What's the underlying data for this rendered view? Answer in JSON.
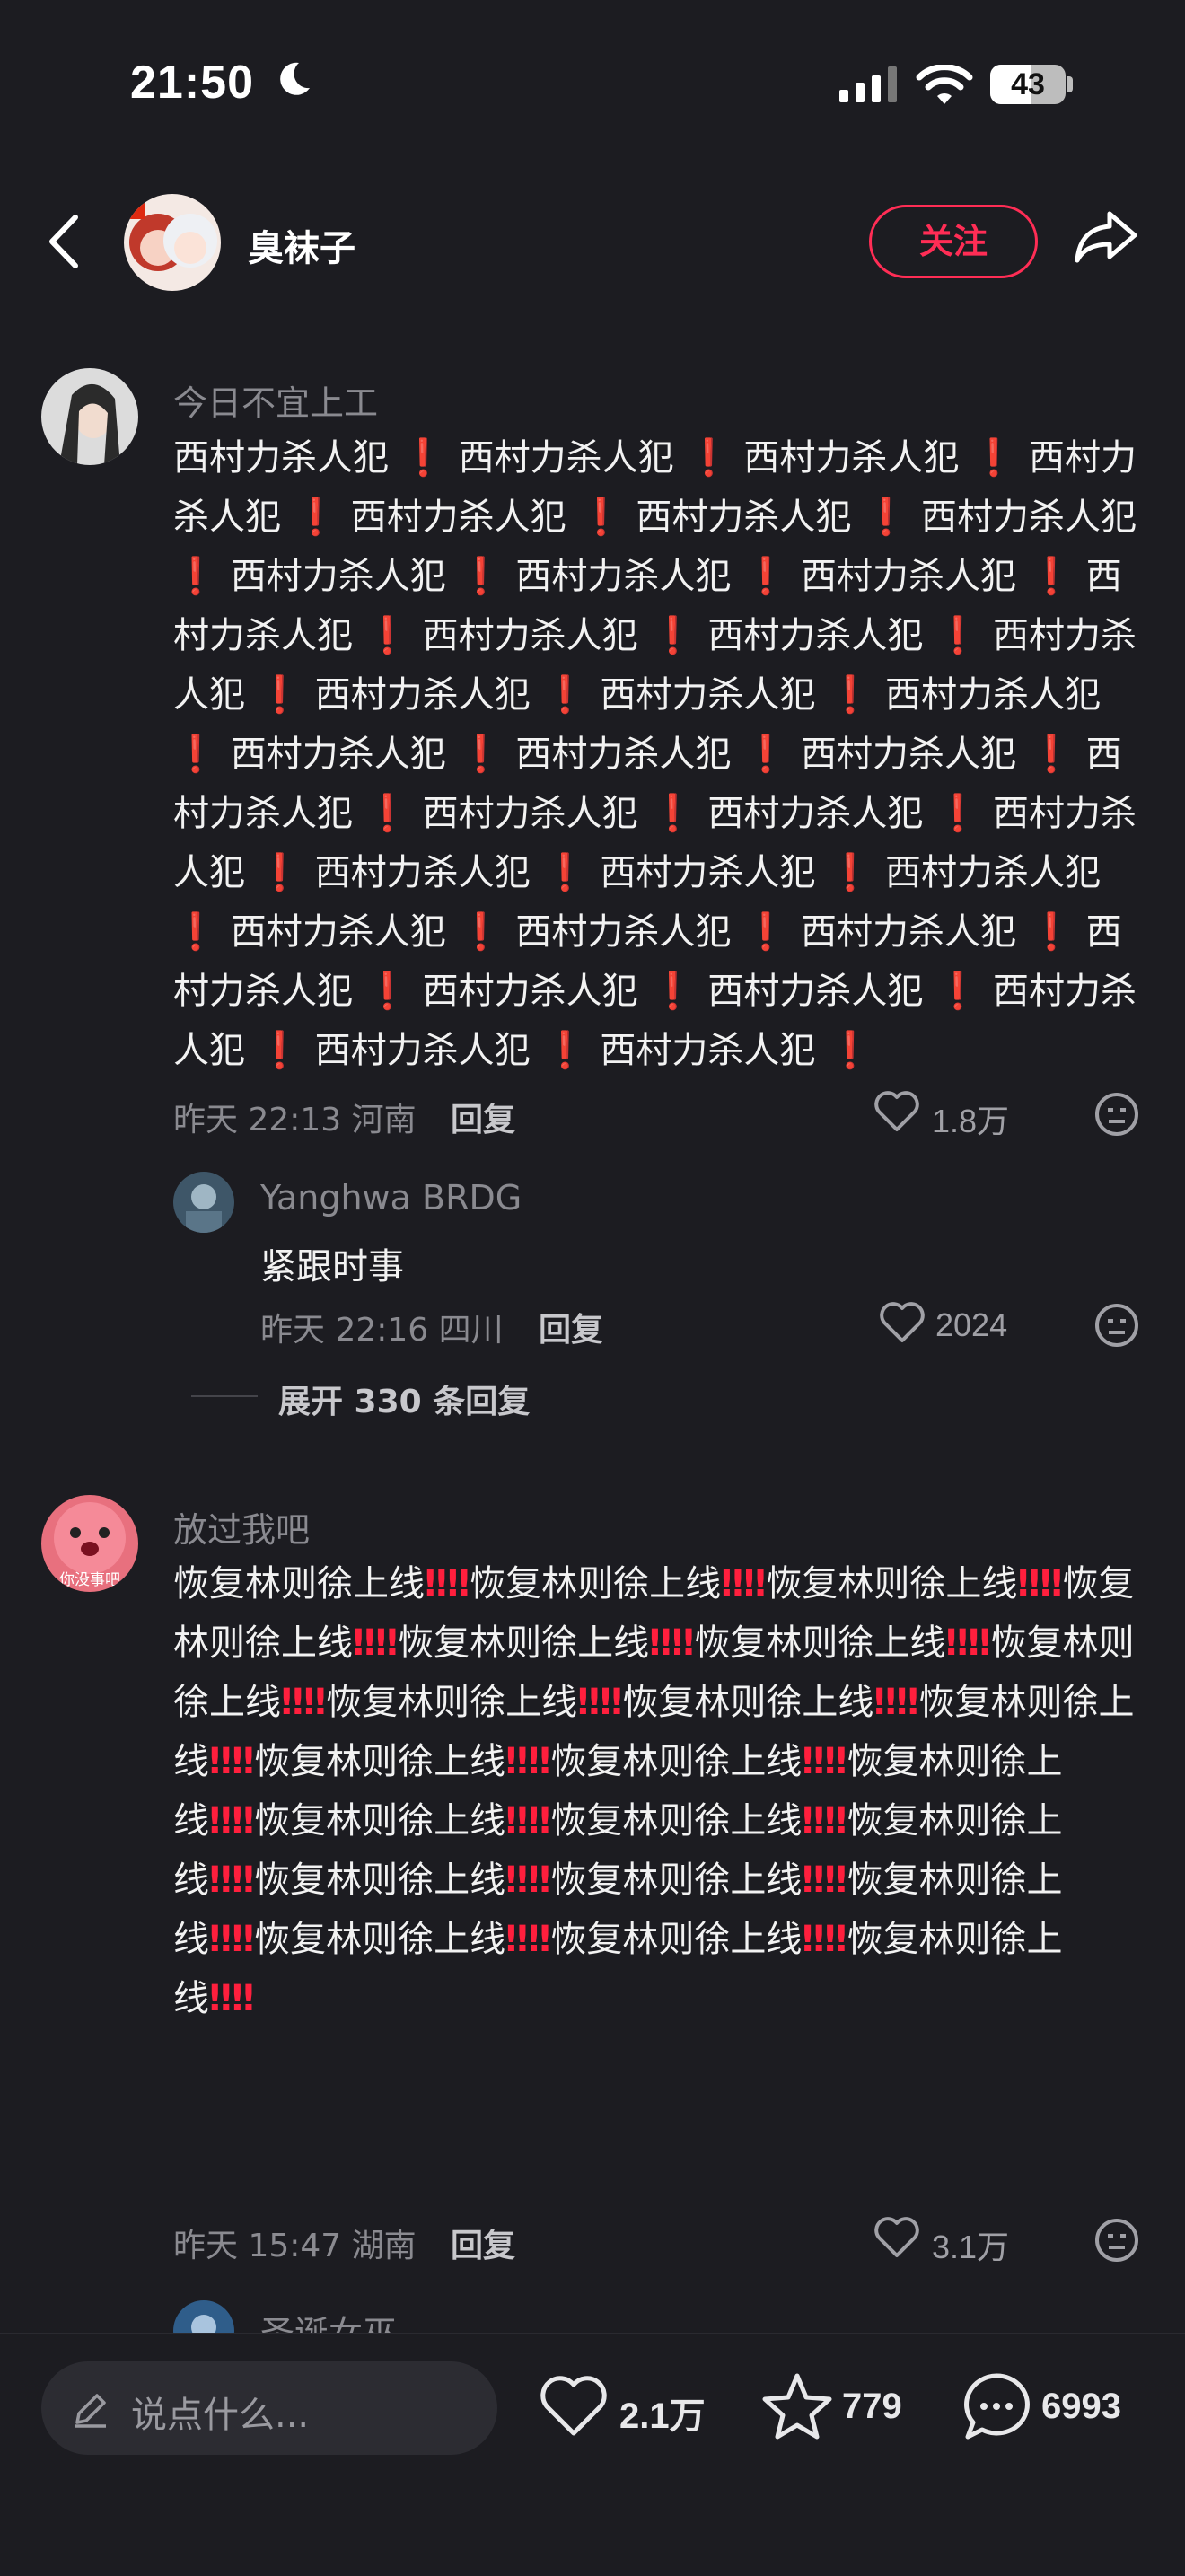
{
  "status": {
    "time": "21:50",
    "battery": "43"
  },
  "header": {
    "author": "臭袜子",
    "follow_label": "关注"
  },
  "comments": [
    {
      "user": "今日不宜上工",
      "text": "西村力杀人犯❗西村力杀人犯❗西村力杀人犯❗西村力杀人犯❗西村力杀人犯❗西村力杀人犯❗西村力杀人犯❗西村力杀人犯❗西村力杀人犯❗西村力杀人犯❗西村力杀人犯❗西村力杀人犯❗西村力杀人犯❗西村力杀人犯❗西村力杀人犯❗西村力杀人犯❗西村力杀人犯❗西村力杀人犯❗西村力杀人犯❗西村力杀人犯❗西村力杀人犯❗西村力杀人犯❗西村力杀人犯❗西村力杀人犯❗西村力杀人犯❗西村力杀人犯❗西村力杀人犯❗西村力杀人犯❗西村力杀人犯❗西村力杀人犯❗西村力杀人犯❗西村力杀人犯❗西村力杀人犯❗西村力杀人犯❗西村力杀人犯❗西村力杀人犯❗",
      "time_loc": "昨天 22:13 河南",
      "reply_label": "回复",
      "likes": "1.8万",
      "sub": {
        "user": "Yanghwa BRDG",
        "text": "紧跟时事",
        "time_loc": "昨天 22:16 四川",
        "reply_label": "回复",
        "likes": "2024"
      },
      "expand": "展开 330 条回复"
    },
    {
      "user": "放过我吧",
      "avatar_text": "你没事吧",
      "text": "恢复林则徐上线‼️‼️恢复林则徐上线‼️‼️恢复林则徐上线‼️‼️恢复林则徐上线‼️‼️恢复林则徐上线‼️‼️恢复林则徐上线‼️‼️恢复林则徐上线‼️‼️恢复林则徐上线‼️‼️恢复林则徐上线‼️‼️恢复林则徐上线‼️‼️恢复林则徐上线‼️‼️恢复林则徐上线‼️‼️恢复林则徐上线‼️‼️恢复林则徐上线‼️‼️恢复林则徐上线‼️‼️恢复林则徐上线‼️‼️恢复林则徐上线‼️‼️恢复林则徐上线‼️‼️恢复林则徐上线‼️‼️恢复林则徐上线‼️‼️恢复林则徐上线‼️‼️恢复林则徐上线‼️‼️",
      "time_loc": "昨天 15:47 湖南",
      "reply_label": "回复",
      "likes": "3.1万"
    },
    {
      "user": "圣诞女巫"
    }
  ],
  "bottom": {
    "placeholder": "说点什么...",
    "likes": "2.1万",
    "favorites": "779",
    "comments": "6993"
  }
}
